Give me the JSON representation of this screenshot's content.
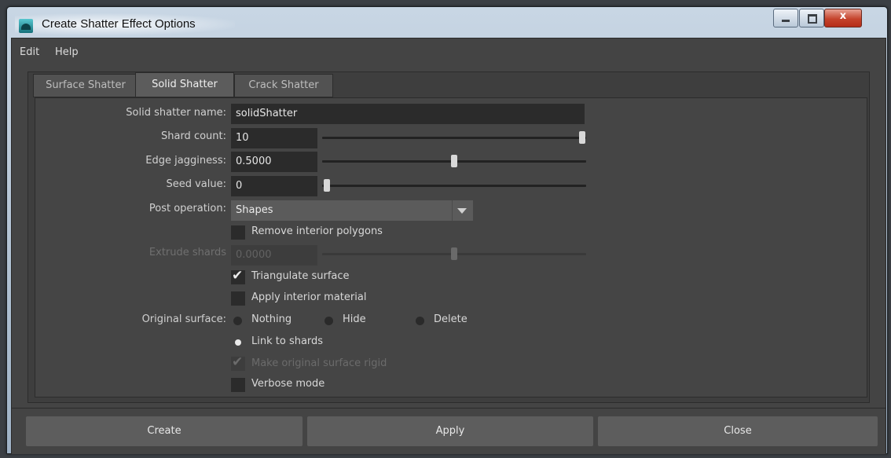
{
  "window": {
    "title": "Create Shatter Effect Options",
    "close_glyph": "x",
    "accent": "#5d5d5d"
  },
  "menu": [
    "Edit",
    "Help"
  ],
  "tabs": [
    {
      "label": "Surface Shatter",
      "active": false
    },
    {
      "label": "Solid Shatter",
      "active": true
    },
    {
      "label": "Crack Shatter",
      "active": false
    }
  ],
  "form": {
    "name_label": "Solid shatter name:",
    "name_value": "solidShatter",
    "shard_label": "Shard count:",
    "shard_value": "10",
    "shard_slider": 1.0,
    "edge_label": "Edge jagginess:",
    "edge_value": "0.5000",
    "edge_slider": 0.5,
    "seed_label": "Seed value:",
    "seed_value": "0",
    "seed_slider": 0.0,
    "post_label": "Post operation:",
    "post_value": "Shapes",
    "remove_interior": {
      "label": "Remove interior polygons",
      "checked": false
    },
    "extrude_label": "Extrude shards",
    "extrude_value": "0.0000",
    "extrude_slider": 0.5,
    "triangulate": {
      "label": "Triangulate surface",
      "checked": true
    },
    "apply_material": {
      "label": "Apply interior material",
      "checked": false
    },
    "original_label": "Original surface:",
    "radios": [
      {
        "label": "Nothing",
        "selected": false
      },
      {
        "label": "Hide",
        "selected": false
      },
      {
        "label": "Delete",
        "selected": false
      },
      {
        "label": "Link to shards",
        "selected": true
      }
    ],
    "make_rigid": {
      "label": "Make original surface rigid",
      "checked": true,
      "enabled": false
    },
    "verbose": {
      "label": "Verbose mode",
      "checked": false
    }
  },
  "buttons": {
    "create": "Create",
    "apply": "Apply",
    "close": "Close"
  }
}
